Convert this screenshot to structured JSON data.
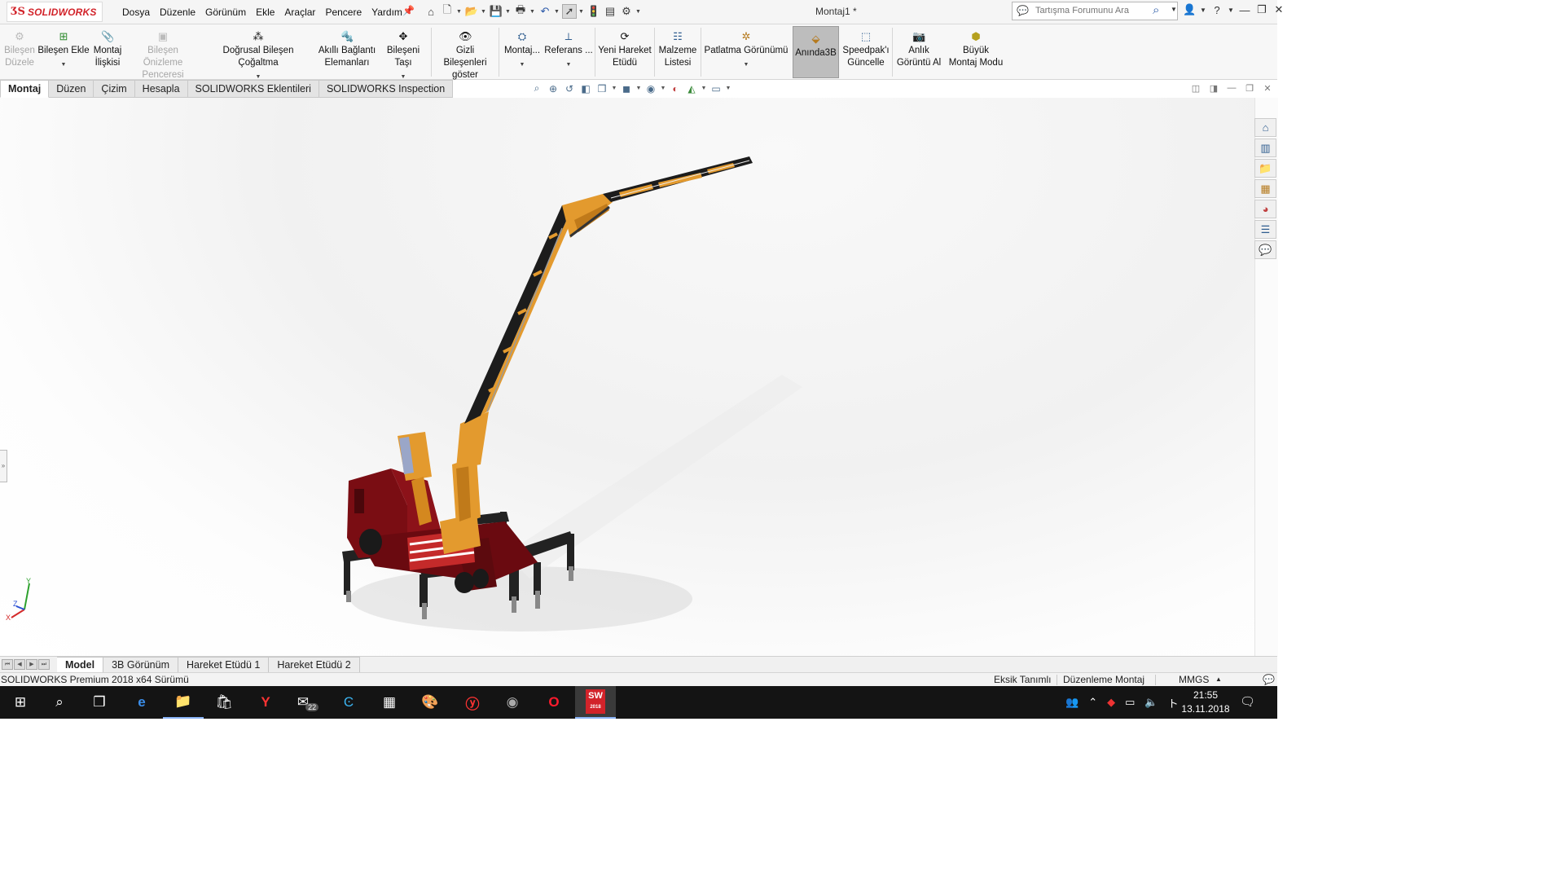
{
  "app": {
    "brand": "SOLIDWORKS",
    "document_title": "Montaj1 *",
    "accent_color": "#d2232a"
  },
  "menu": [
    "Dosya",
    "Düzenle",
    "Görünüm",
    "Ekle",
    "Araçlar",
    "Pencere",
    "Yardım"
  ],
  "quick_access_icons": [
    "home-icon",
    "new-document-icon",
    "open-icon",
    "save-icon",
    "print-icon",
    "undo-icon",
    "select-arrow-icon",
    "rebuild-icon",
    "file-properties-icon",
    "options-gear-icon"
  ],
  "search": {
    "placeholder": "Tartışma Forumunu Ara"
  },
  "ribbon": [
    {
      "label": "Bileşen\nDüzele",
      "icon": "edit-component-icon",
      "disabled": true
    },
    {
      "label": "Bileşen Ekle",
      "icon": "insert-component-icon",
      "caret": true
    },
    {
      "label": "Montaj\nİlişkisi",
      "icon": "mate-icon"
    },
    {
      "label": "Bileşen Önizleme\nPenceresi",
      "icon": "component-preview-icon",
      "disabled": true
    },
    {
      "label": "Doğrusal Bileşen Çoğaltma",
      "icon": "linear-pattern-icon",
      "caret": true
    },
    {
      "label": "Akıllı Bağlantı\nElemanları",
      "icon": "smart-fasteners-icon"
    },
    {
      "label": "Bileşeni Taşı",
      "icon": "move-component-icon",
      "caret": true
    },
    {
      "label": "Gizli Bileşenleri\ngöster",
      "icon": "show-hidden-icon"
    },
    {
      "label": "Montaj...",
      "icon": "assembly-features-icon",
      "caret": true
    },
    {
      "label": "Referans ...",
      "icon": "reference-geometry-icon",
      "caret": true
    },
    {
      "label": "Yeni Hareket\nEtüdü",
      "icon": "motion-study-icon"
    },
    {
      "label": "Malzeme\nListesi",
      "icon": "bom-icon"
    },
    {
      "label": "Patlatma Görünümü",
      "icon": "exploded-view-icon",
      "caret": true
    },
    {
      "label": "Anında3B",
      "icon": "instant3d-icon",
      "active": true
    },
    {
      "label": "Speedpak'ı\nGüncelle",
      "icon": "speedpak-icon"
    },
    {
      "label": "Anlık\nGörüntü Al",
      "icon": "snapshot-icon"
    },
    {
      "label": "Büyük\nMontaj Modu",
      "icon": "large-assembly-icon"
    }
  ],
  "tabs": [
    {
      "label": "Montaj",
      "active": true
    },
    {
      "label": "Düzen"
    },
    {
      "label": "Çizim"
    },
    {
      "label": "Hesapla"
    },
    {
      "label": "SOLIDWORKS Eklentileri"
    },
    {
      "label": "SOLIDWORKS Inspection"
    }
  ],
  "heads_up_icons": [
    "zoom-to-fit-icon",
    "zoom-area-icon",
    "previous-view-icon",
    "section-view-icon",
    "view-orientation-icon",
    "display-style-icon",
    "hide-show-icon",
    "appearance-icon",
    "scene-icon",
    "display-settings-icon"
  ],
  "task_pane_icons": [
    "resources-home-icon",
    "design-library-icon",
    "file-explorer-icon",
    "view-palette-icon",
    "appearances-icon",
    "custom-properties-icon",
    "forum-icon"
  ],
  "triad": {
    "x": "X",
    "y": "Y",
    "z": "Z"
  },
  "model_colors": {
    "crane": "#e39a2e",
    "boom_black": "#1c1c1c",
    "truck_body": "#7a0d13",
    "outrigger": "#222222"
  },
  "bottom_tabs": [
    {
      "label": "Model",
      "active": true
    },
    {
      "label": "3B Görünüm"
    },
    {
      "label": "Hareket Etüdü 1"
    },
    {
      "label": "Hareket Etüdü 2"
    }
  ],
  "status": {
    "version": "SOLIDWORKS Premium 2018 x64 Sürümü",
    "definition": "Eksik Tanımlı",
    "mode": "Düzenleme Montaj",
    "units": "MMGS"
  },
  "taskbar": {
    "mail_badge": "22",
    "time": "21:55",
    "date": "13.11.2018",
    "solidworks_year": "2018"
  }
}
